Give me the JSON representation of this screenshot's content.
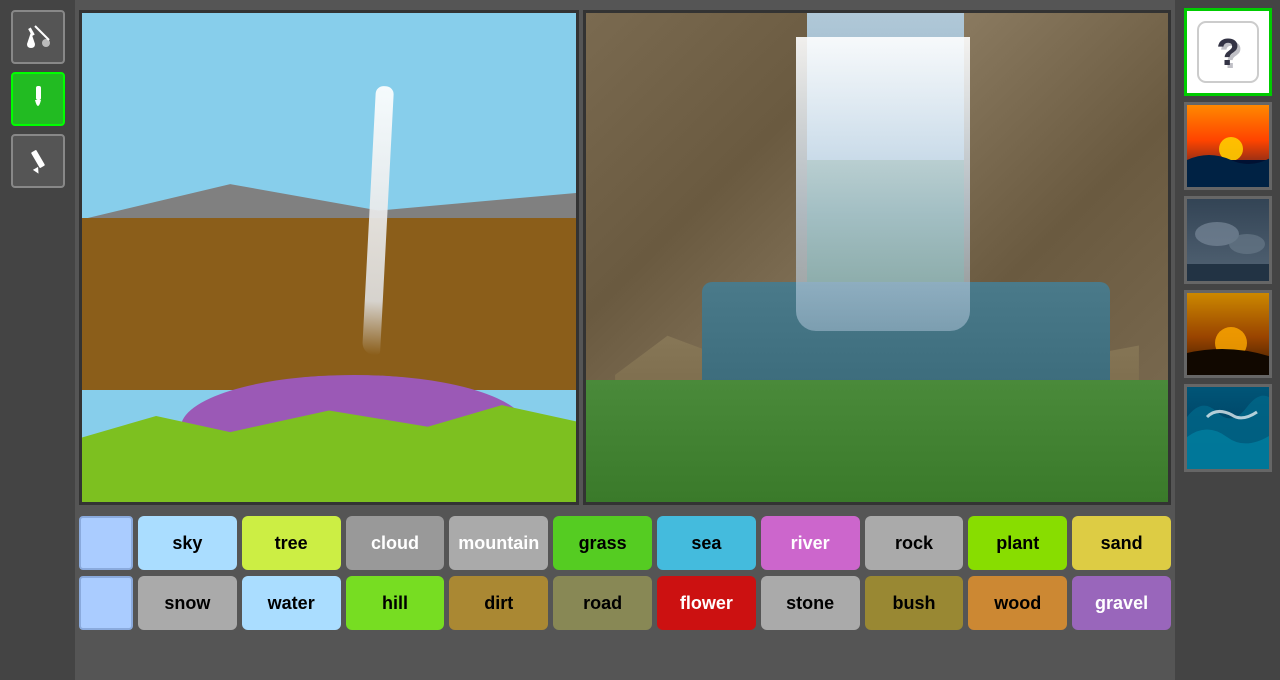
{
  "tools": [
    {
      "id": "fill-tool",
      "label": "Fill Tool",
      "icon": "fill",
      "active": false
    },
    {
      "id": "brush-tool",
      "label": "Brush Tool",
      "icon": "brush",
      "active": true
    },
    {
      "id": "pencil-tool",
      "label": "Pencil Tool",
      "icon": "pencil",
      "active": false
    }
  ],
  "labels_row1": [
    {
      "id": "blank",
      "label": "",
      "color": "#aaccff",
      "text_color": "#000"
    },
    {
      "id": "sky",
      "label": "sky",
      "color": "#aaddff",
      "text_color": "#000"
    },
    {
      "id": "tree",
      "label": "tree",
      "color": "#ccee44",
      "text_color": "#000"
    },
    {
      "id": "cloud",
      "label": "cloud",
      "color": "#999999",
      "text_color": "#fff"
    },
    {
      "id": "mountain",
      "label": "mountain",
      "color": "#aaaaaa",
      "text_color": "#fff"
    },
    {
      "id": "grass",
      "label": "grass",
      "color": "#55cc22",
      "text_color": "#000"
    },
    {
      "id": "sea",
      "label": "sea",
      "color": "#44bbdd",
      "text_color": "#000"
    },
    {
      "id": "river",
      "label": "river",
      "color": "#cc66cc",
      "text_color": "#fff"
    },
    {
      "id": "rock",
      "label": "rock",
      "color": "#aaaaaa",
      "text_color": "#000"
    },
    {
      "id": "plant",
      "label": "plant",
      "color": "#88dd00",
      "text_color": "#000"
    },
    {
      "id": "sand",
      "label": "sand",
      "color": "#ddcc44",
      "text_color": "#000"
    }
  ],
  "labels_row2": [
    {
      "id": "blank2",
      "label": "",
      "color": "#aaccff",
      "text_color": "#000"
    },
    {
      "id": "snow",
      "label": "snow",
      "color": "#aaaaaa",
      "text_color": "#000"
    },
    {
      "id": "water",
      "label": "water",
      "color": "#aaddff",
      "text_color": "#000"
    },
    {
      "id": "hill",
      "label": "hill",
      "color": "#77dd22",
      "text_color": "#000"
    },
    {
      "id": "dirt",
      "label": "dirt",
      "color": "#aa8833",
      "text_color": "#000"
    },
    {
      "id": "road",
      "label": "road",
      "color": "#888855",
      "text_color": "#000"
    },
    {
      "id": "flower",
      "label": "flower",
      "color": "#cc1111",
      "text_color": "#fff"
    },
    {
      "id": "stone",
      "label": "stone",
      "color": "#aaaaaa",
      "text_color": "#000"
    },
    {
      "id": "bush",
      "label": "bush",
      "color": "#998833",
      "text_color": "#000"
    },
    {
      "id": "wood",
      "label": "wood",
      "color": "#cc8833",
      "text_color": "#000"
    },
    {
      "id": "gravel",
      "label": "gravel",
      "color": "#9966bb",
      "text_color": "#fff"
    }
  ],
  "thumbnails": [
    {
      "id": "dice",
      "label": "Random Dice",
      "type": "dice"
    },
    {
      "id": "sunset",
      "label": "Sunset Scene",
      "type": "sunset"
    },
    {
      "id": "clouds",
      "label": "Cloud Scene",
      "type": "clouds"
    },
    {
      "id": "sundown",
      "label": "Sundown Scene",
      "type": "sundown"
    },
    {
      "id": "wave",
      "label": "Wave Scene",
      "type": "wave"
    }
  ]
}
